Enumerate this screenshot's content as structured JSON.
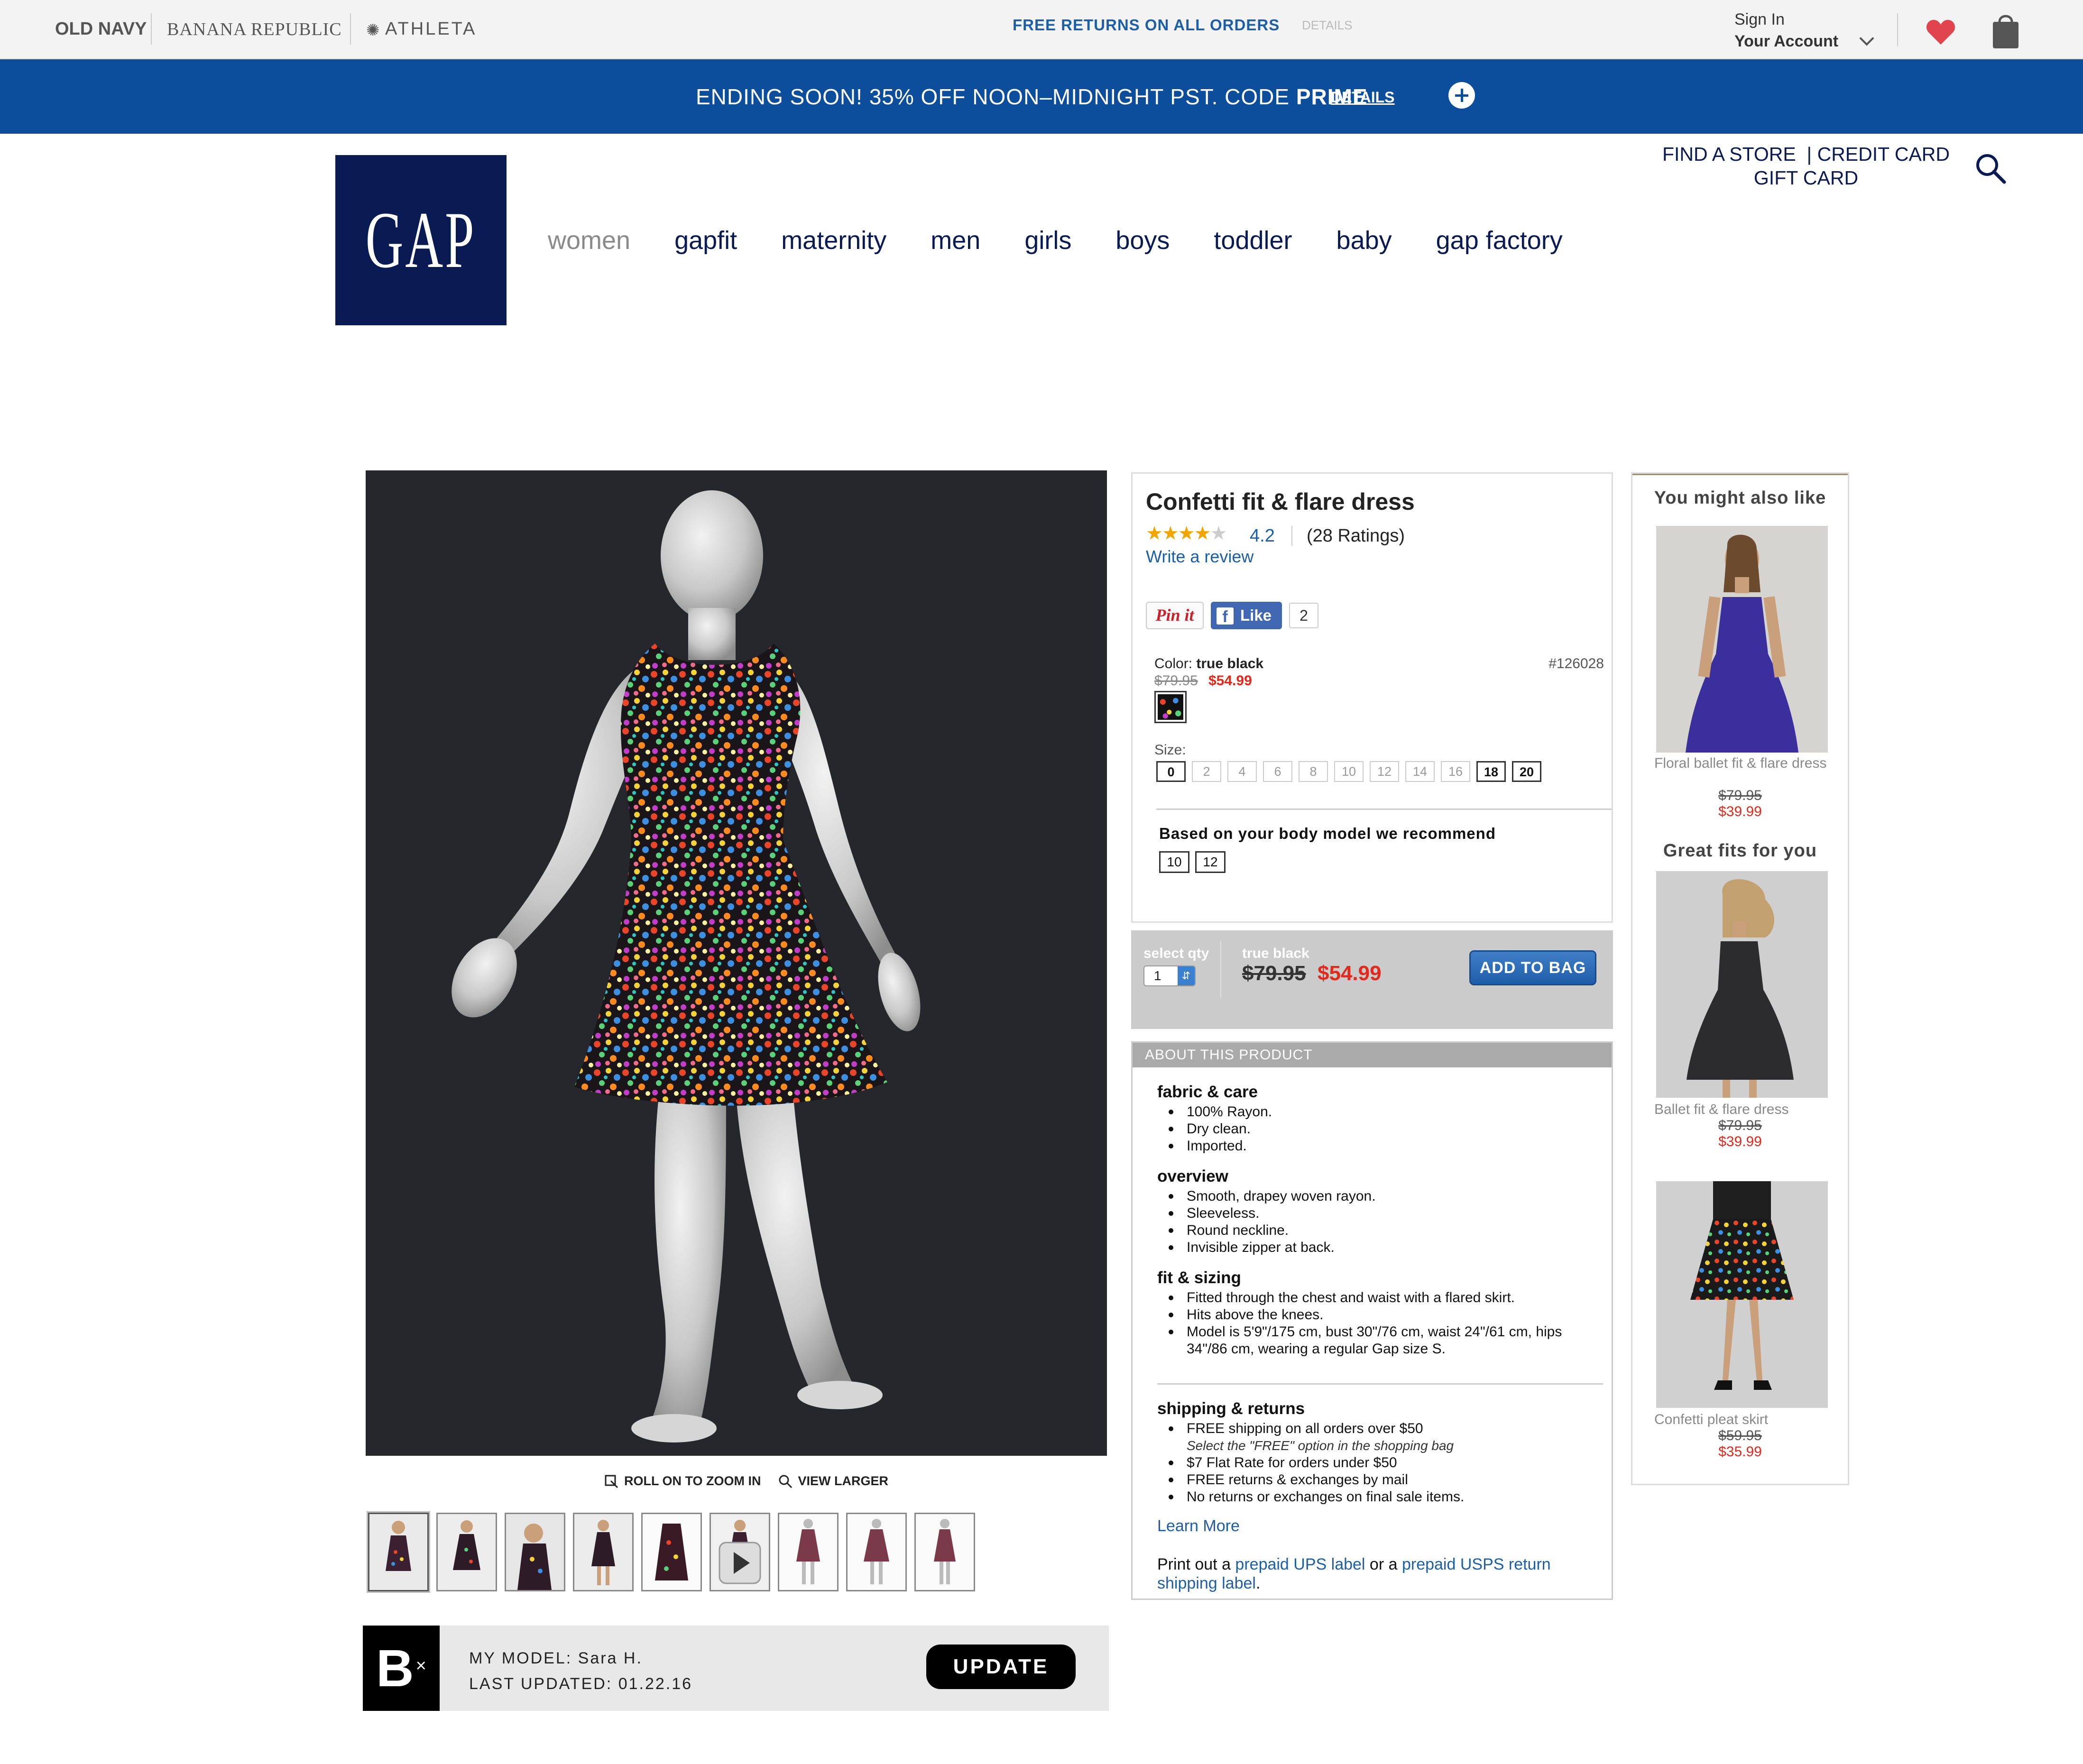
{
  "brand_bar": {
    "brands": [
      "OLD NAVY",
      "BANANA REPUBLIC",
      "ATHLETA"
    ],
    "free_returns": "FREE RETURNS ON ALL ORDERS",
    "details": "DETAILS",
    "sign_in": "Sign In",
    "your_account": "Your Account",
    "icons": [
      "chevron-down-icon",
      "heart-icon",
      "shopping-bag-icon"
    ],
    "heart_color": "#e0454f"
  },
  "promo": {
    "text_prefix": "ENDING SOON! 35% OFF NOON–MIDNIGHT PST. CODE ",
    "code": "PRIME",
    "details": "DETAILS",
    "background": "#0d4e9c"
  },
  "header": {
    "logo": "GAP",
    "logo_color": "#0a1a53",
    "nav": [
      "women",
      "gapfit",
      "maternity",
      "men",
      "girls",
      "boys",
      "toddler",
      "baby",
      "gap factory"
    ],
    "active_nav": "women",
    "find_store": "FIND A STORE",
    "credit_card": "CREDIT CARD",
    "gift_card": "GIFT CARD"
  },
  "gallery": {
    "zoom_label": "ROLL ON TO ZOOM IN",
    "view_larger": "VIEW LARGER",
    "thumb_count": 9
  },
  "model_bar": {
    "logo": "B",
    "logo_mark": "×",
    "my_model_label": "MY MODEL:",
    "my_model_value": "Sara H.",
    "last_updated_label": "LAST UPDATED:",
    "last_updated_value": "01.22.16",
    "update_button": "UPDATE"
  },
  "product": {
    "title": "Confetti fit & flare dress",
    "rating": "4.2",
    "rating_stars": 4.2,
    "ratings_count": "(28 Ratings)",
    "write_review": "Write a review",
    "pin_it": "Pin it",
    "like": "Like",
    "like_count": "2",
    "color_label": "Color:",
    "color_value": "true black",
    "style_number": "#126028",
    "original_price": "$79.95",
    "sale_price": "$54.99",
    "size_label": "Size:",
    "sizes": [
      "0",
      "2",
      "4",
      "6",
      "8",
      "10",
      "12",
      "14",
      "16",
      "18",
      "20"
    ],
    "available_sizes": [
      "0",
      "18",
      "20"
    ],
    "recommend_text": "Based on your body model we  recommend",
    "recommended_sizes": [
      "10",
      "12"
    ]
  },
  "add_to_bag": {
    "qty_label": "select qty",
    "qty_value": "1",
    "color_label": "true black",
    "original_price": "$79.95",
    "sale_price": "$54.99",
    "button": "ADD TO BAG"
  },
  "about": {
    "heading": "ABOUT THIS PRODUCT",
    "fabric_title": "fabric & care",
    "fabric": [
      "100% Rayon.",
      "Dry clean.",
      "Imported."
    ],
    "overview_title": "overview",
    "overview": [
      "Smooth, drapey woven rayon.",
      "Sleeveless.",
      "Round neckline.",
      "Invisible zipper at back."
    ],
    "fit_title": "fit & sizing",
    "fit": [
      "Fitted through the chest and waist with a flared skirt.",
      "Hits above the knees.",
      "Model is 5'9\"/175 cm, bust 30\"/76 cm, waist 24\"/61 cm, hips 34\"/86 cm, wearing a regular Gap size S."
    ],
    "shipping_title": "shipping & returns",
    "shipping_1": "FREE shipping on all orders over $50",
    "shipping_note": "Select the \"FREE\" option in the shopping bag",
    "shipping_2": "$7 Flat Rate for orders under $50",
    "shipping_3": "FREE returns & exchanges by mail",
    "shipping_4": "No returns or exchanges on final sale items.",
    "learn_more": "Learn More",
    "print_prefix": "Print out a ",
    "ups_link": "prepaid UPS label",
    "print_mid": " or a ",
    "usps_link": "prepaid USPS return shipping label",
    "print_suffix": "."
  },
  "rail": {
    "heading_1": "You might also like",
    "heading_2": "Great fits for you",
    "items": [
      {
        "name": "Floral ballet fit & flare dress",
        "original": "$79.95",
        "sale": "$39.99",
        "dress_color": "#3b2f9e"
      },
      {
        "name": "Ballet fit & flare dress",
        "original": "$79.95",
        "sale": "$39.99",
        "dress_color": "#2c2c2e"
      },
      {
        "name": "Confetti pleat skirt",
        "original": "$59.95",
        "sale": "$35.99",
        "dress_color": "#1a1a1a"
      }
    ]
  }
}
